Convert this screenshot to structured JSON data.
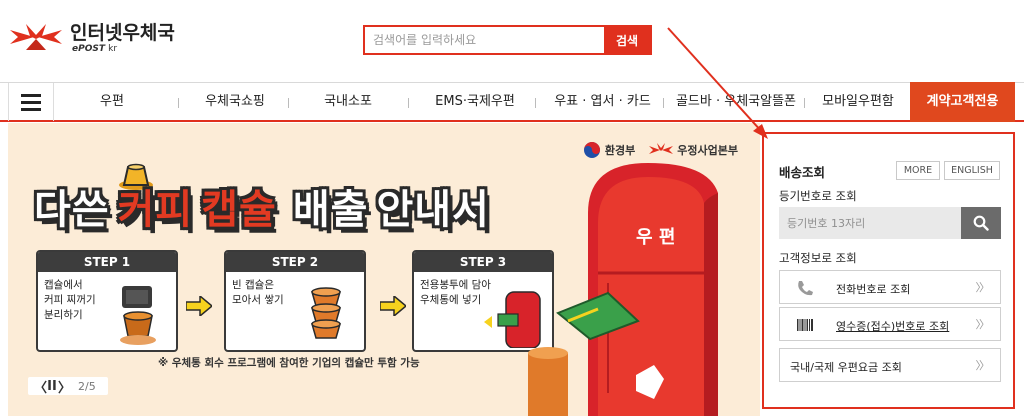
{
  "header": {
    "logo_title": "인터넷우체국",
    "logo_sub_brand": "ePOST",
    "logo_sub_tld": "kr",
    "search_placeholder": "검색어를 입력하세요",
    "search_button": "검색"
  },
  "nav": {
    "menu_icon": "hamburger-icon",
    "items": [
      "우편",
      "우체국쇼핑",
      "국내소포",
      "EMS·국제우편",
      "우표 · 엽서 · 카드",
      "골드바 · 우체국알뜰폰",
      "모바일우편함"
    ],
    "special": "계약고객전용"
  },
  "banner": {
    "sponsors": [
      "환경부",
      "우정사업본부"
    ],
    "headline": [
      "다쓴",
      "커피",
      "캡슐",
      "배출",
      "안내서"
    ],
    "steps": [
      {
        "title": "STEP 1",
        "lines": [
          "캡슐에서",
          "커피 찌꺼기",
          "분리하기"
        ]
      },
      {
        "title": "STEP 2",
        "lines": [
          "빈 캡슐은",
          "모아서 쌓기"
        ]
      },
      {
        "title": "STEP 3",
        "lines": [
          "전용봉투에 담아",
          "우체통에 넣기"
        ]
      }
    ],
    "note": "※ 우체통 회수 프로그램에 참여한 기업의 캡슐만 투함 가능",
    "postbox_text": "우 편",
    "pager": {
      "prev": "〈",
      "pause": "II",
      "next": "〉",
      "count": "2/5"
    }
  },
  "panel": {
    "title": "배송조회",
    "more_button": "MORE",
    "english_button": "ENGLISH",
    "registered_label": "등기번호로 조회",
    "registered_placeholder": "등기번호 13자리",
    "search_icon": "search-icon",
    "customer_label": "고객정보로 조회",
    "phone_lookup": "전화번호로 조회",
    "receipt_lookup": "영수증(접수)번호로 조회",
    "rate_lookup": "국내/국제 우편요금 조회",
    "chevron": "〉〉"
  },
  "colors": {
    "brand_red": "#e0301e",
    "special_orange": "#e0481e",
    "banner_bg": "#fcecd7",
    "dark_gray": "#3d3d3d"
  }
}
